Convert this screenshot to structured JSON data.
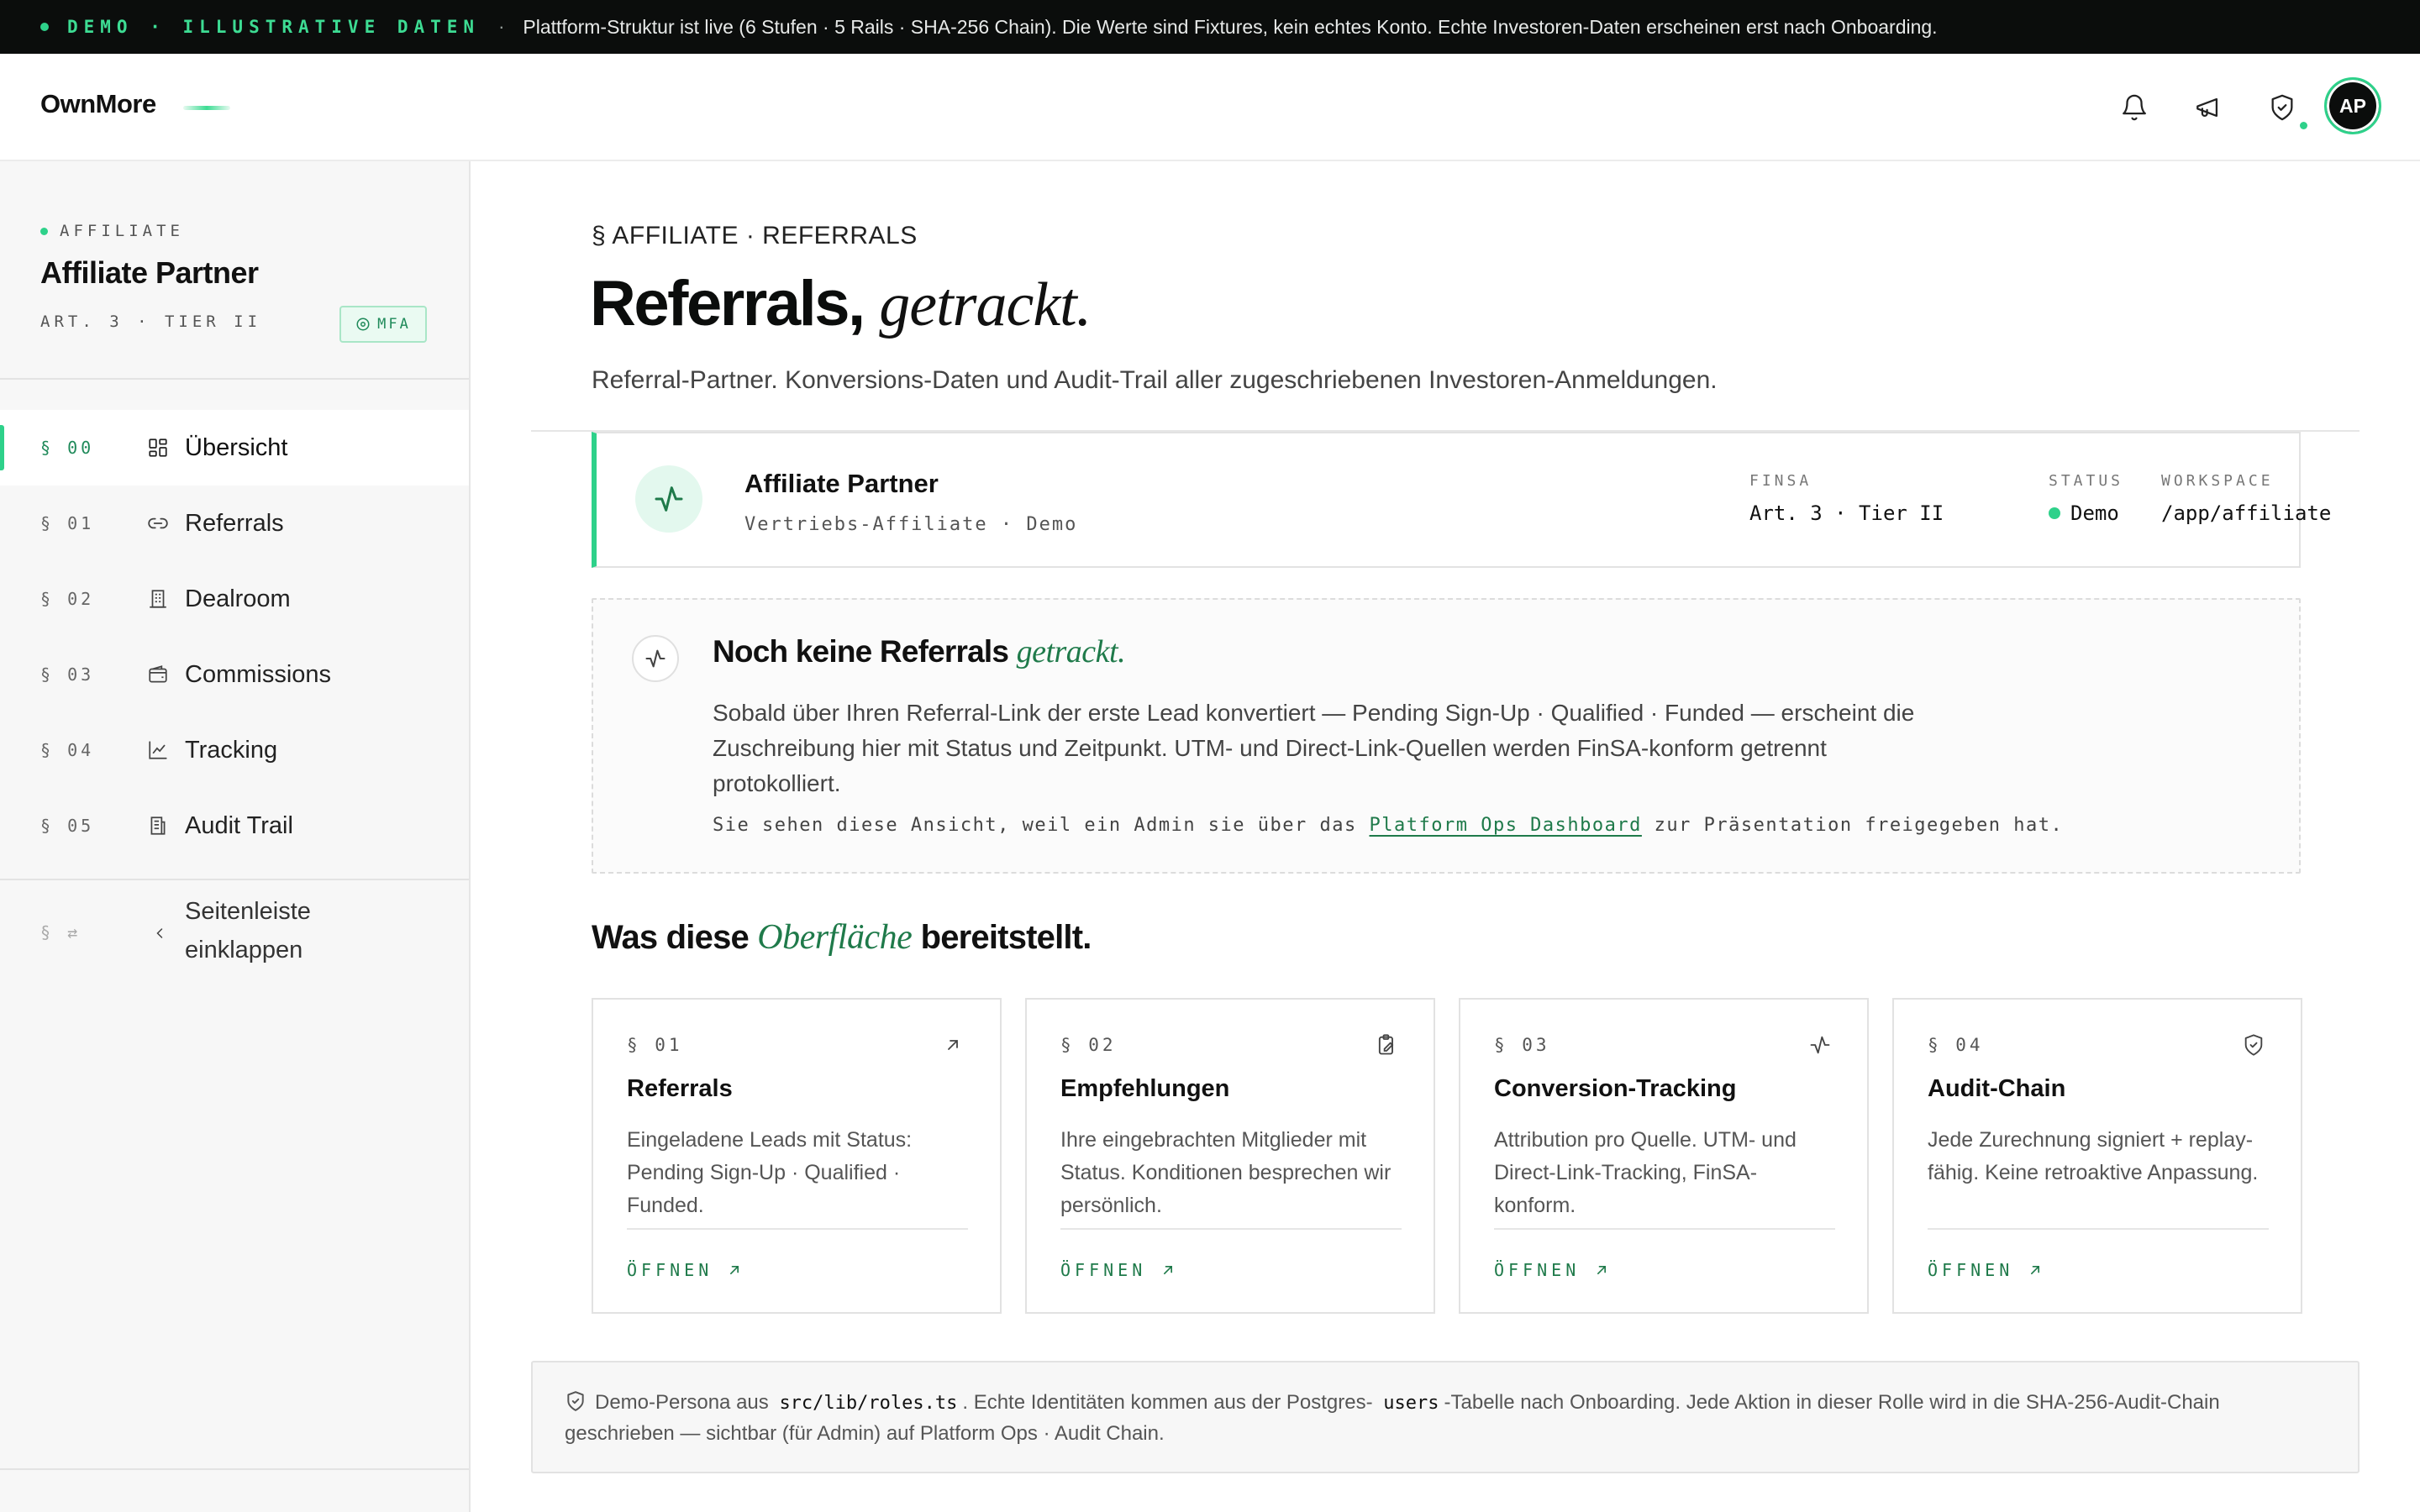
{
  "banner": {
    "tag": "DEMO · ILLUSTRATIVE DATEN",
    "separator": "·",
    "message": "Plattform-Struktur ist live (6 Stufen · 5 Rails · SHA-256 Chain). Die Werte sind Fixtures, kein echtes Konto. Echte Investoren-Daten erscheinen erst nach Onboarding."
  },
  "header": {
    "logo": "OwnMore",
    "icons": [
      "bell-icon",
      "megaphone-icon",
      "shield-check-icon"
    ],
    "avatar_initials": "AP"
  },
  "sidebar": {
    "role_label": "AFFILIATE",
    "title": "Affiliate Partner",
    "subtitle": "ART. 3 · TIER II",
    "mfa_badge": "MFA",
    "items": [
      {
        "num": "§ 00",
        "label": "Übersicht",
        "icon": "grid-icon",
        "active": true
      },
      {
        "num": "§ 01",
        "label": "Referrals",
        "icon": "link-icon"
      },
      {
        "num": "§ 02",
        "label": "Dealroom",
        "icon": "building-icon"
      },
      {
        "num": "§ 03",
        "label": "Commissions",
        "icon": "wallet-icon"
      },
      {
        "num": "§ 04",
        "label": "Tracking",
        "icon": "chart-line-icon"
      },
      {
        "num": "§ 05",
        "label": "Audit Trail",
        "icon": "receipt-icon"
      }
    ],
    "collapse": {
      "num": "§ ⇄",
      "label": "Seitenleiste einklappen"
    }
  },
  "main": {
    "eyebrow": "§ AFFILIATE · REFERRALS",
    "title_strong": "Referrals,",
    "title_italic": "getrackt.",
    "lead": "Referral-Partner. Konversions-Daten und Audit-Trail aller zugeschriebenen Investoren-Anmeldungen.",
    "profile": {
      "name": "Affiliate Partner",
      "sub": "Vertriebs-Affiliate · Demo",
      "meta": [
        {
          "key": "FINSA",
          "value": "Art. 3 · Tier II"
        },
        {
          "key": "STATUS",
          "value": "Demo"
        },
        {
          "key": "WORKSPACE",
          "value": "/app/affiliate"
        }
      ]
    },
    "empty": {
      "title_strong": "Noch keine Referrals",
      "title_italic": "getrackt.",
      "body": "Sobald über Ihren Referral-Link der erste Lead konvertiert — Pending Sign-Up · Qualified · Funded — erscheint die Zuschreibung hier mit Status und Zeitpunkt. UTM- und Direct-Link-Quellen werden FinSA-konform getrennt protokolliert.",
      "note_before": "Sie sehen diese Ansicht, weil ein Admin sie über das",
      "note_link": "Platform Ops Dashboard",
      "note_after": "zur Präsentation freigegeben hat."
    },
    "section_title": {
      "before": "Was diese",
      "italic": "Oberfläche",
      "after": "bereitstellt."
    },
    "cards": [
      {
        "num": "§ 01",
        "title": "Referrals",
        "body": "Eingeladene Leads mit Status: Pending Sign-Up · Qualified · Funded.",
        "cta": "ÖFFNEN",
        "icon": "arrow-up-right-icon"
      },
      {
        "num": "§ 02",
        "title": "Empfehlungen",
        "body": "Ihre eingebrachten Mitglieder mit Status. Konditionen besprechen wir persönlich.",
        "cta": "ÖFFNEN",
        "icon": "clipboard-edit-icon"
      },
      {
        "num": "§ 03",
        "title": "Conversion-Tracking",
        "body": "Attribution pro Quelle. UTM- und Direct-Link-Tracking, FinSA-konform.",
        "cta": "ÖFFNEN",
        "icon": "activity-icon"
      },
      {
        "num": "§ 04",
        "title": "Audit-Chain",
        "body": "Jede Zurechnung signiert + replay-fähig. Keine retroaktive Anpassung.",
        "cta": "ÖFFNEN",
        "icon": "shield-check-icon"
      }
    ],
    "footnote": {
      "t1": "Demo-Persona aus",
      "code1": "src/lib/roles.ts",
      "t2": ". Echte Identitäten kommen aus der Postgres-",
      "code2": "users",
      "t3": "-Tabelle nach Onboarding. Jede Aktion in dieser Rolle wird in die SHA-256-Audit-Chain geschrieben — sichtbar (für Admin) auf Platform Ops · Audit Chain."
    }
  },
  "colors": {
    "accent": "#2ed18a",
    "accent_dark": "#1f7a4a",
    "banner_bg": "#0b0d0c"
  }
}
